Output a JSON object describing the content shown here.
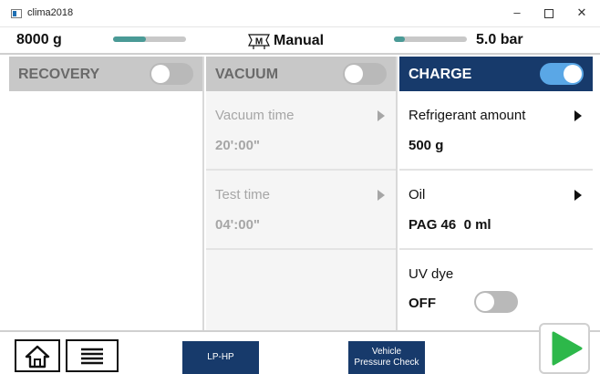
{
  "window": {
    "title": "clima2018",
    "minimize_label": "–",
    "close_label": "✕"
  },
  "status": {
    "weight": "8000 g",
    "weight_level": 0.45,
    "mode": "Manual",
    "pressure": "5.0 bar",
    "pressure_level": 0.15,
    "mode_icon": "manifold-m-icon"
  },
  "panels": {
    "recovery": {
      "title": "RECOVERY",
      "enabled": false
    },
    "vacuum": {
      "title": "VACUUM",
      "enabled": false,
      "rows": [
        {
          "label": "Vacuum time",
          "value": "20':00\""
        },
        {
          "label": "Test time",
          "value": "04':00\""
        }
      ]
    },
    "charge": {
      "title": "CHARGE",
      "enabled": true,
      "rows": [
        {
          "label": "Refrigerant amount",
          "value": "500 g"
        },
        {
          "label": "Oil",
          "value": "PAG 46  0 ml"
        },
        {
          "label": "UV dye",
          "value": "OFF",
          "enabled": false
        }
      ]
    }
  },
  "bottom": {
    "lphp_label": "LP-HP",
    "vehicle_line1": "Vehicle",
    "vehicle_line2": "Pressure Check"
  },
  "colors": {
    "accent_navy": "#173a6b",
    "toggle_on": "#5aa7e6",
    "level_teal": "#4a9a96",
    "play_green": "#2db84a"
  }
}
